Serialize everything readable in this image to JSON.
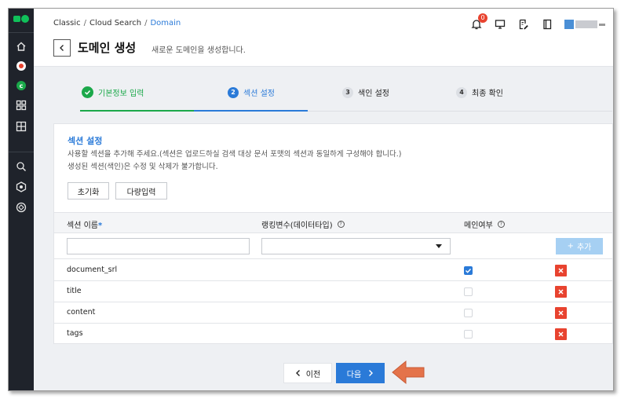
{
  "breadcrumb": {
    "items": [
      "Classic",
      "Cloud Search"
    ],
    "current": "Domain"
  },
  "header": {
    "title": "도메인 생성",
    "description": "새로운 도메인을 생성합니다.",
    "notification_count": "0"
  },
  "sidebar": {
    "icons": [
      "home-icon",
      "flag-icon",
      "service-c-icon",
      "grid-icon",
      "chart-grid-icon",
      "search-user-icon",
      "settings-hex-icon",
      "cycle-icon"
    ]
  },
  "steps": [
    {
      "num": "1",
      "label": "기본정보 입력",
      "state": "done"
    },
    {
      "num": "2",
      "label": "섹션 설정",
      "state": "active"
    },
    {
      "num": "3",
      "label": "색인 설정",
      "state": "pending"
    },
    {
      "num": "4",
      "label": "최종 확인",
      "state": "pending"
    }
  ],
  "section": {
    "title": "섹션 설정",
    "desc_line1": "사용할 섹션을 추가해 주세요.(섹션은 업로드하실 검색 대상 문서 포맷의 섹션과 동일하게 구성해야 합니다.)",
    "desc_line2": "생성된 섹션(색인)은 수정 및 삭제가 불가합니다."
  },
  "buttons": {
    "reset": "초기화",
    "bulk_input": "다량입력",
    "add": "추가",
    "prev": "이전",
    "next": "다음"
  },
  "table": {
    "headers": {
      "name": "섹션 이름",
      "ranking": "랭킹변수(데이터타입)",
      "main": "메인여부"
    },
    "required_mark": "*",
    "rows": [
      {
        "name": "document_srl",
        "main": true
      },
      {
        "name": "title",
        "main": false
      },
      {
        "name": "content",
        "main": false
      },
      {
        "name": "tags",
        "main": false
      }
    ]
  },
  "colors": {
    "accent": "#2a7ad8",
    "success": "#1ba84a",
    "danger": "#e8432f",
    "sidebar": "#1f232b",
    "annotation_arrow": "#e4734a"
  }
}
